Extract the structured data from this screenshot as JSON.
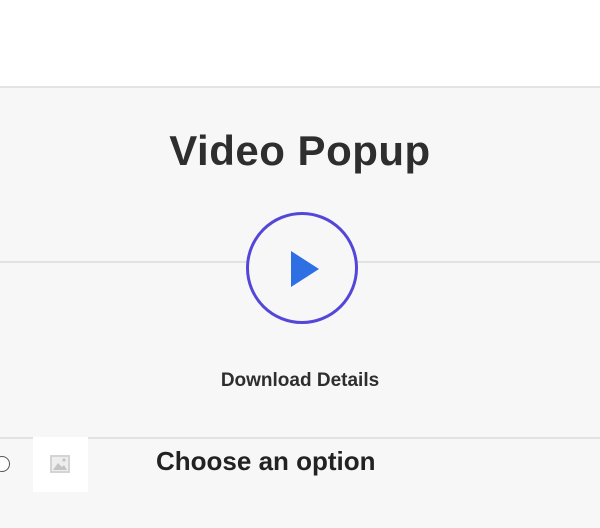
{
  "main": {
    "title": "Video Popup",
    "download_label": "Download Details"
  },
  "option": {
    "heading": "Choose an option"
  },
  "icons": {
    "play": "play-icon",
    "image_placeholder": "image-placeholder-icon"
  },
  "colors": {
    "accent_circle": "#5446d8",
    "play_triangle": "#2f6fe4",
    "section_bg": "#f7f7f7"
  }
}
